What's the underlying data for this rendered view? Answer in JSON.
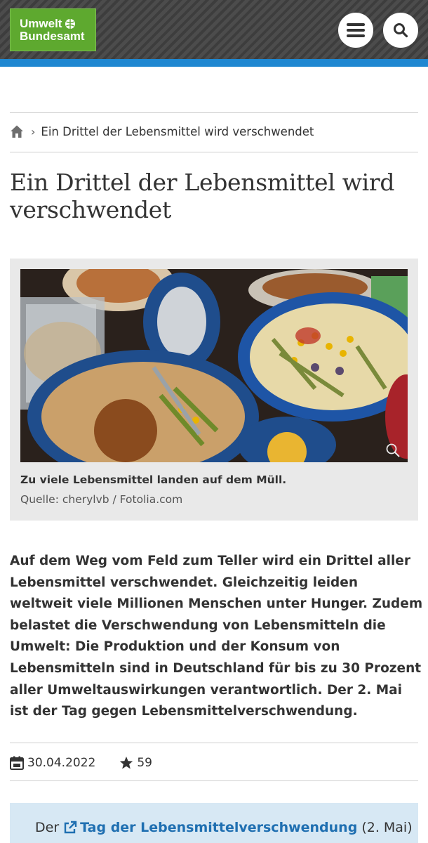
{
  "header": {
    "logo_line1": "Umwelt",
    "logo_line2": "Bundesamt",
    "icons": {
      "menu": "hamburger-icon",
      "search": "search-icon",
      "home": "home-icon"
    },
    "colors": {
      "logo_green": "#5ea92f",
      "accent_blue": "#1f87d1",
      "link_blue": "#1f6fb1"
    }
  },
  "breadcrumb": {
    "current": "Ein Drittel der Lebensmittel wird verschwendet"
  },
  "page_title": "Ein Drittel der Lebensmittel wird verschwendet",
  "figure": {
    "caption": "Zu viele Lebensmittel landen auf dem Müll.",
    "credit": "Quelle: cherylvb / Fotolia.com"
  },
  "lead": "Auf dem Weg vom Feld zum Teller wird ein Drittel aller Lebensmittel verschwendet. Gleichzeitig leiden weltweit viele Millionen Menschen unter Hunger. Zudem belastet die Verschwendung von Lebensmitteln die Umwelt: Die Produktion und der Konsum von Lebensmitteln sind in Deutschland für bis zu 30 Prozent aller Umweltauswirkungen verantwortlich. Der 2. Mai ist der Tag gegen Lebensmittelverschwendung.",
  "meta": {
    "date": "30.04.2022",
    "rating_count": "59"
  },
  "infobox": {
    "prefix": "Der",
    "link_text": "Tag der Lebensmittelverschwendung",
    "suffix": "(2. Mai)"
  }
}
